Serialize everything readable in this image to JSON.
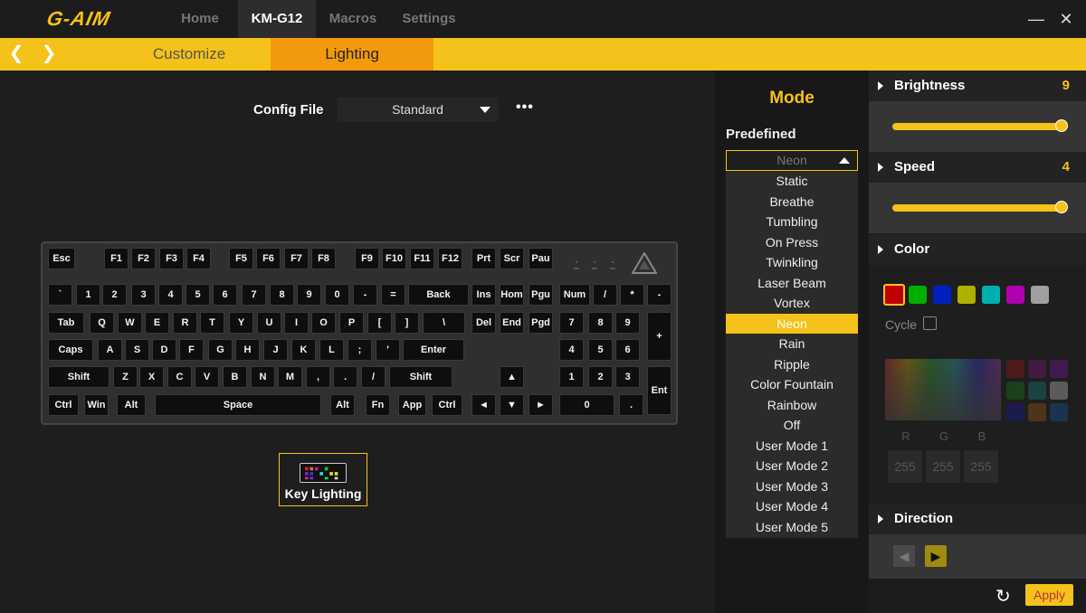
{
  "app": {
    "logo": "G-AIM"
  },
  "nav": {
    "tabs": [
      "Home",
      "KM-G12",
      "Macros",
      "Settings"
    ],
    "active": "KM-G12"
  },
  "window": {
    "minimize": "—",
    "close": "✕"
  },
  "subnav": {
    "prev": "❮",
    "next": "❯",
    "tabs": [
      "Customize",
      "Lighting"
    ],
    "active": "Lighting"
  },
  "config": {
    "label": "Config File",
    "value": "Standard",
    "more": "•••"
  },
  "keyboard": {
    "rows": [
      [
        "Esc",
        "F1",
        "F2",
        "F3",
        "F4",
        "F5",
        "F6",
        "F7",
        "F8",
        "F9",
        "F10",
        "F11",
        "F12",
        "Prt",
        "Scr",
        "Pau"
      ],
      [
        "`",
        "1",
        "2",
        "3",
        "4",
        "5",
        "6",
        "7",
        "8",
        "9",
        "0",
        "-",
        "=",
        "Back",
        "Ins",
        "Hom",
        "Pgu",
        "Num",
        "/",
        "*",
        "-"
      ],
      [
        "Tab",
        "Q",
        "W",
        "E",
        "R",
        "T",
        "Y",
        "U",
        "I",
        "O",
        "P",
        "[",
        "]",
        "\\",
        "Del",
        "End",
        "Pgd",
        "7",
        "8",
        "9",
        "+"
      ],
      [
        "Caps",
        "A",
        "S",
        "D",
        "F",
        "G",
        "H",
        "J",
        "K",
        "L",
        ";",
        "'",
        "Enter",
        "4",
        "5",
        "6"
      ],
      [
        "Shift",
        "Z",
        "X",
        "C",
        "V",
        "B",
        "N",
        "M",
        ",",
        ".",
        "/",
        "Shift",
        "▲",
        "1",
        "2",
        "3",
        "Ent"
      ],
      [
        "Ctrl",
        "Win",
        "Alt",
        "Space",
        "Alt",
        "Fn",
        "App",
        "Ctrl",
        "◄",
        "▼",
        "►",
        "0",
        "."
      ]
    ]
  },
  "key_lighting": {
    "label": "Key Lighting",
    "icon": "keyboard-rgb-icon"
  },
  "mode": {
    "title": "Mode",
    "predefined_label": "Predefined",
    "selected": "Neon",
    "options": [
      "Static",
      "Breathe",
      "Tumbling",
      "On Press",
      "Twinkling",
      "Laser Beam",
      "Vortex",
      "Neon",
      "Rain",
      "Ripple",
      "Color Fountain",
      "Rainbow",
      "Off",
      "User Mode 1",
      "User Mode 2",
      "User Mode 3",
      "User Mode 4",
      "User Mode 5"
    ]
  },
  "brightness": {
    "label": "Brightness",
    "value": "9",
    "level": 1.0
  },
  "speed": {
    "label": "Speed",
    "value": "4",
    "level": 1.0
  },
  "color": {
    "label": "Color",
    "swatches": [
      "#c00000",
      "#00b000",
      "#0020c0",
      "#b0b000",
      "#00b0b0",
      "#b000b0",
      "#a0a0a0"
    ],
    "cycle_label": "Cycle",
    "preset_grid": [
      "#5a1a1a",
      "#4a1a4a",
      "#4a1a5a",
      "#1a4a1a",
      "#1a4a4a",
      "#6a6a6a",
      "#1a1a5a",
      "#5a3a1a",
      "#1a3a5a"
    ],
    "r_label": "R",
    "g_label": "G",
    "b_label": "B",
    "r": "255",
    "g": "255",
    "b": "255"
  },
  "direction": {
    "label": "Direction",
    "left": "◀",
    "right": "▶"
  },
  "footer": {
    "refresh": "↻",
    "apply": "Apply"
  },
  "colors": {
    "accent": "#f4c21a",
    "orange": "#f39a0c",
    "bg": "#1e1e1e"
  }
}
